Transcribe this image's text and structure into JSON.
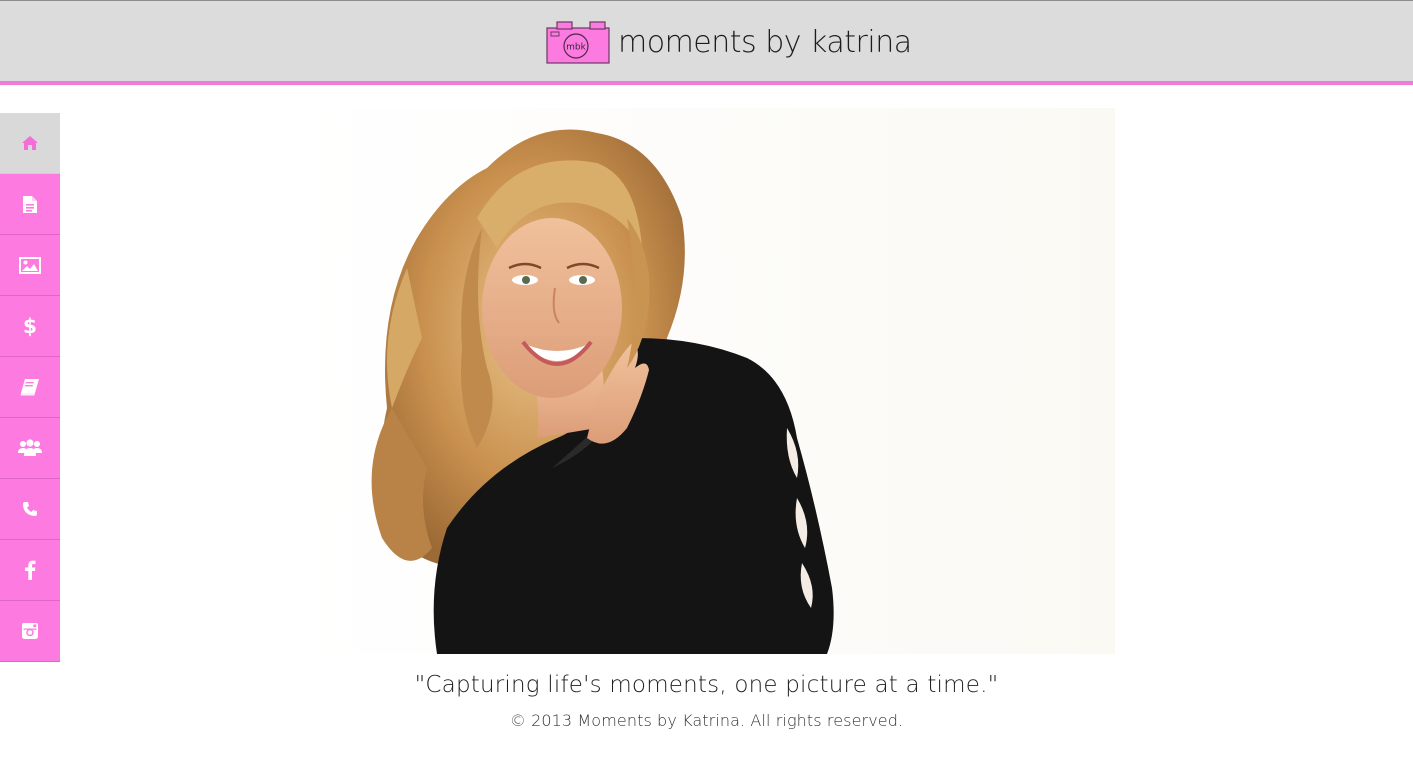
{
  "brand": {
    "logo_text": "moments by katrina",
    "logo_monogram": "mbk",
    "accent_color": "#f07ad8",
    "nav_color": "#fd7be1",
    "header_bg": "#dcdcdc"
  },
  "sidebar": {
    "items": [
      {
        "icon": "home-icon",
        "active": true
      },
      {
        "icon": "document-icon",
        "active": false
      },
      {
        "icon": "image-icon",
        "active": false
      },
      {
        "icon": "dollar-icon",
        "active": false
      },
      {
        "icon": "book-icon",
        "active": false
      },
      {
        "icon": "users-icon",
        "active": false
      },
      {
        "icon": "phone-icon",
        "active": false
      },
      {
        "icon": "facebook-icon",
        "active": false
      },
      {
        "icon": "instagram-icon",
        "active": false
      }
    ]
  },
  "main": {
    "hero_alt": "Smiling woman with long curly blonde hair in a black top",
    "quote": "\"Capturing life's moments, one picture at a time.\"",
    "copyright": "© 2013 Moments by Katrina. All rights reserved."
  }
}
